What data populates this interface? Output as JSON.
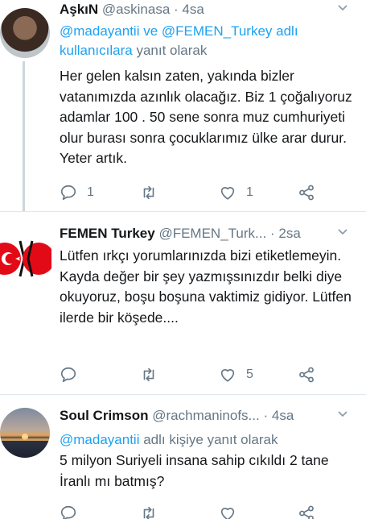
{
  "tweets": [
    {
      "name": "AşkıN",
      "handle": "@askinasa",
      "dot": "·",
      "time": "4sa",
      "reply_prefix_mentions": "@madayantii ve @FEMEN_Turkey adlı kullanıcılara",
      "reply_suffix": "yanıt olarak",
      "body": "Her gelen kalsın zaten, yakında bizler vatanımızda azınlık olacağız. Biz 1 çoğalıyoruz adamlar 100 . 50 sene sonra muz cumhuriyeti olur burası sonra çocuklarımız ülke arar durur. Yeter artık.",
      "reply_count": "1",
      "retweet_count": "",
      "like_count": "1"
    },
    {
      "name": "FEMEN Turkey",
      "handle": "@FEMEN_Turk...",
      "dot": "·",
      "time": "2sa",
      "body": "Lütfen ırkçı yorumlarınızda bizi etiketlemeyin. Kayda değer bir şey yazmışsınızdır belki diye okuyoruz, boşu boşuna vaktimiz gidiyor. Lütfen ilerde bir köşede....",
      "reply_count": "",
      "retweet_count": "",
      "like_count": "5"
    },
    {
      "name": "Soul Crimson",
      "handle": "@rachmaninofs...",
      "dot": "·",
      "time": "4sa",
      "reply_mention": "@madayantii",
      "reply_suffix": "adlı kişiye yanıt olarak",
      "body": "5 milyon Suriyeli insana sahip cıkıldı 2 tane İranlı mı batmış?"
    }
  ],
  "icons": {
    "reply": "reply-icon",
    "retweet": "retweet-icon",
    "like": "heart-icon",
    "share": "share-icon",
    "more": "chevron-down-icon"
  },
  "colors": {
    "link": "#1da1f2",
    "secondary_text": "#657786",
    "divider": "#e1e8ed",
    "femen_red": "#e30a17"
  }
}
